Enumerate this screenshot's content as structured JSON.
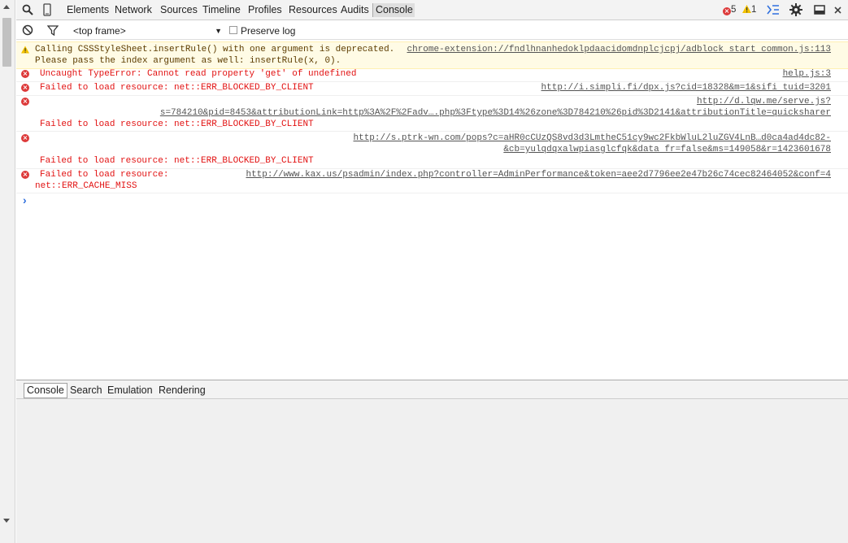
{
  "toolbar": {
    "tabs": [
      "Elements",
      "Network",
      "Sources",
      "Timeline",
      "Profiles",
      "Resources",
      "Audits",
      "Console"
    ],
    "error_count": "5",
    "warning_count": "1"
  },
  "subbar": {
    "frame_select": "<top frame>",
    "preserve_log_label": "Preserve log"
  },
  "messages": [
    {
      "type": "warning",
      "line1": "Calling CSSStyleSheet.insertRule() with one argument is deprecated.",
      "line2": "Please pass the index argument as well: insertRule(x, 0).",
      "source": "chrome-extension://fndlhnanhedoklpdaacidomdnplcjcpj/adblock start common.js:113"
    },
    {
      "type": "error",
      "text": "Uncaught TypeError: Cannot read property 'get' of undefined",
      "source": "help.js:3"
    },
    {
      "type": "error",
      "text": "Failed to load resource: net::ERR_BLOCKED_BY_CLIENT",
      "source": "http://i.simpli.fi/dpx.js?cid=18328&m=1&sifi tuid=3201"
    },
    {
      "type": "error",
      "source_line1": "http://d.lqw.me/serve.js?",
      "source_line2": "s=784210&pid=8453&attributionLink=http%3A%2F%2Fadv….php%3Ftype%3D14%26zone%3D784210%26pid%3D2141&attributionTitle=quicksharer",
      "text": "Failed to load resource: net::ERR_BLOCKED_BY_CLIENT"
    },
    {
      "type": "error",
      "source_line1": "http://s.ptrk-wn.com/pops?c=aHR0cCUzQS8vd3d3LmtheC51cy9wc2FkbWluL2luZGV4LnB…d0ca4ad4dc82-",
      "source_line2": "&cb=yulqdqxalwpiasglcfqk&data fr=false&ms=149058&r=1423601678",
      "text": "Failed to load resource: net::ERR_BLOCKED_BY_CLIENT"
    },
    {
      "type": "error",
      "text": "Failed to load resource:",
      "source": "http://www.kax.us/psadmin/index.php?controller=AdminPerformance&token=aee2d7796ee2e47b26c74cec82464052&conf=4",
      "text2": "net::ERR_CACHE_MISS"
    }
  ],
  "prompt_symbol": "›",
  "drawer": {
    "tabs": [
      "Console",
      "Search",
      "Emulation",
      "Rendering"
    ]
  }
}
